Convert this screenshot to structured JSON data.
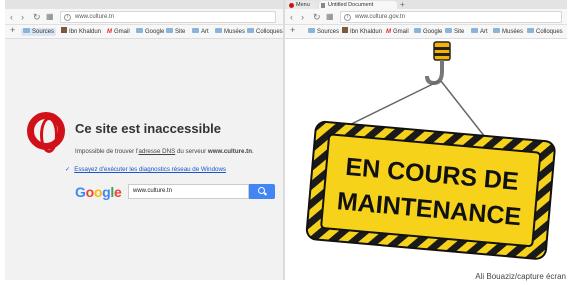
{
  "left_browser": {
    "url": "www.culture.tn",
    "bookmarks": [
      "Sources",
      "Ibn Khaldun",
      "Gmail",
      "Google",
      "Site",
      "Art",
      "Musées",
      "Colloques"
    ],
    "error_title": "Ce site est inaccessible",
    "error_msg_prefix": "Impossible de trouver l'",
    "error_msg_link": "adresse DNS",
    "error_msg_middle": " du serveur ",
    "error_msg_domain": "www.culture.tn",
    "error_msg_suffix": ".",
    "diagnostics_link": "Essayez d'exécuter les diagnostics réseau de Windows",
    "google_logo": [
      "G",
      "o",
      "o",
      "g",
      "l",
      "e"
    ],
    "google_search_value": "www.culture.tn"
  },
  "right_browser": {
    "tabs": [
      "Menu",
      "Untitled Document"
    ],
    "url": "www.culture.gov.tn",
    "bookmarks": [
      "Sources",
      "Ibn Khaldun",
      "Gmail",
      "Google",
      "Site",
      "Art",
      "Musées",
      "Colloques"
    ],
    "sign_line1": "EN COURS DE",
    "sign_line2": "MAINTENANCE"
  },
  "credit": "Ali Bouaziz/capture écran",
  "colors": {
    "opera_red": "#d11119",
    "google_blue": "#4285f4",
    "sign_yellow": "#f6d21b",
    "link_blue": "#1a56c7"
  }
}
